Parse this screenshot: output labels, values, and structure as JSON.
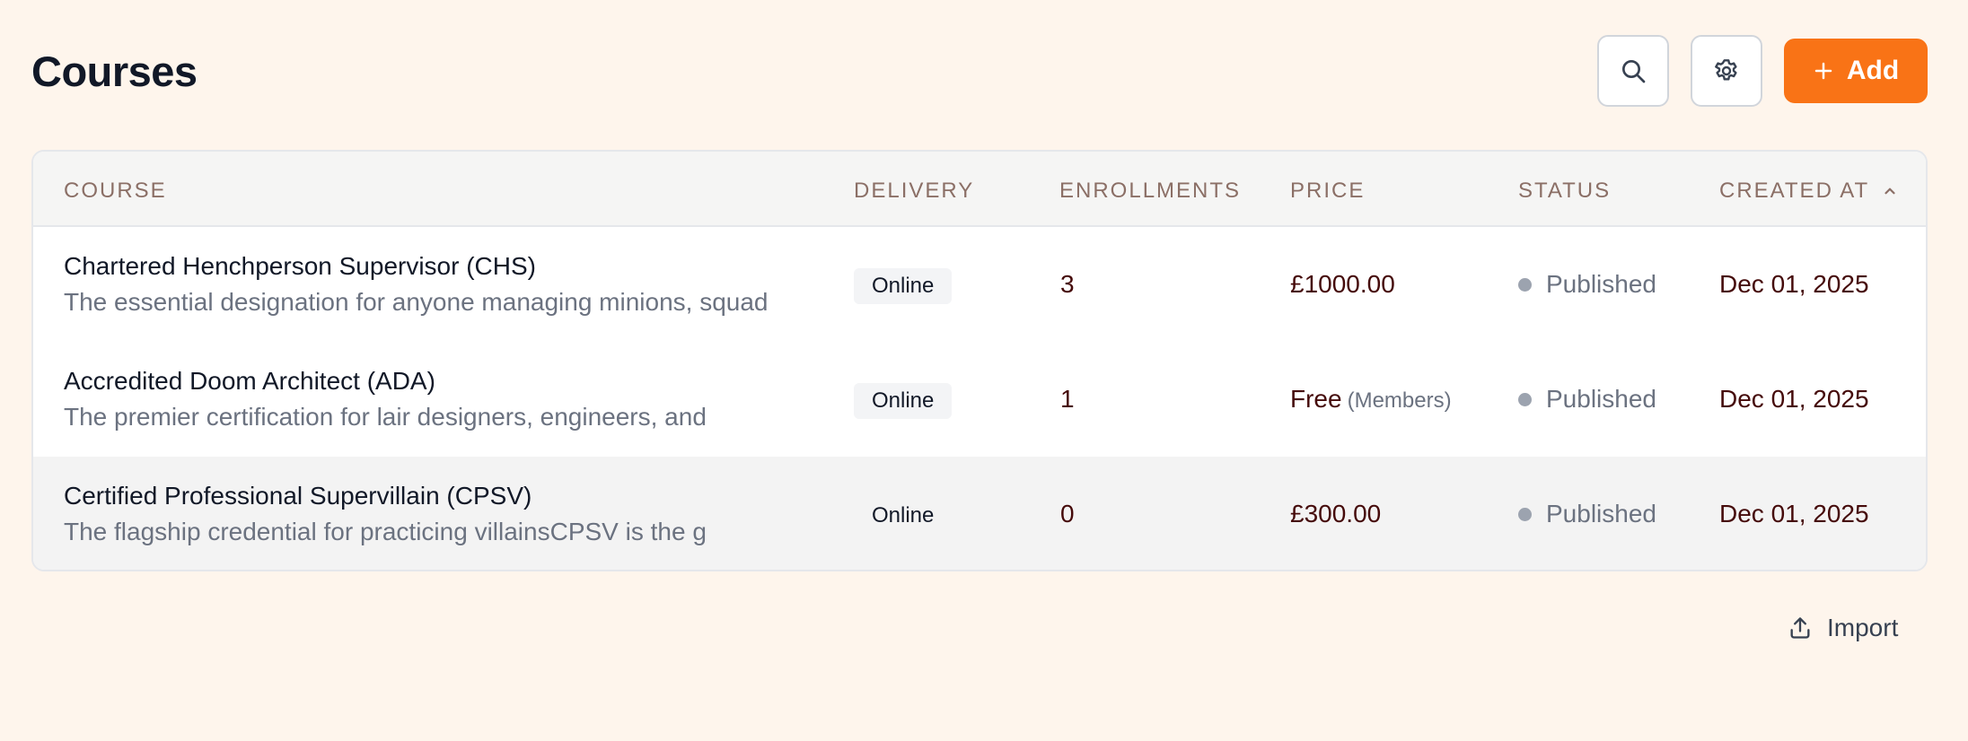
{
  "header": {
    "title": "Courses",
    "search_icon": "search-icon",
    "settings_icon": "gear-icon",
    "add_label": "Add",
    "add_icon": "plus-icon",
    "accent_color": "#f97316"
  },
  "table": {
    "columns": {
      "course": "COURSE",
      "delivery": "DELIVERY",
      "enrollments": "ENROLLMENTS",
      "price": "PRICE",
      "status": "STATUS",
      "created_at": "CREATED AT",
      "sort_icon": "chevron-up-icon"
    },
    "rows": [
      {
        "name": "Chartered Henchperson Supervisor (CHS)",
        "description": "The essential designation for anyone managing minions, squad",
        "delivery": "Online",
        "enrollments": "3",
        "price": "£1000.00",
        "price_note": "",
        "status": "Published",
        "created_at": "Dec 01, 2025"
      },
      {
        "name": "Accredited Doom Architect (ADA)",
        "description": "The premier certification for lair designers, engineers, and",
        "delivery": "Online",
        "enrollments": "1",
        "price": "Free",
        "price_note": "(Members)",
        "status": "Published",
        "created_at": "Dec 01, 2025"
      },
      {
        "name": "Certified Professional Supervillain (CPSV)",
        "description": "The flagship credential for practicing villainsCPSV is the g",
        "delivery": "Online",
        "enrollments": "0",
        "price": "£300.00",
        "price_note": "",
        "status": "Published",
        "created_at": "Dec 01, 2025"
      }
    ]
  },
  "footer": {
    "import_label": "Import",
    "import_icon": "upload-icon"
  }
}
